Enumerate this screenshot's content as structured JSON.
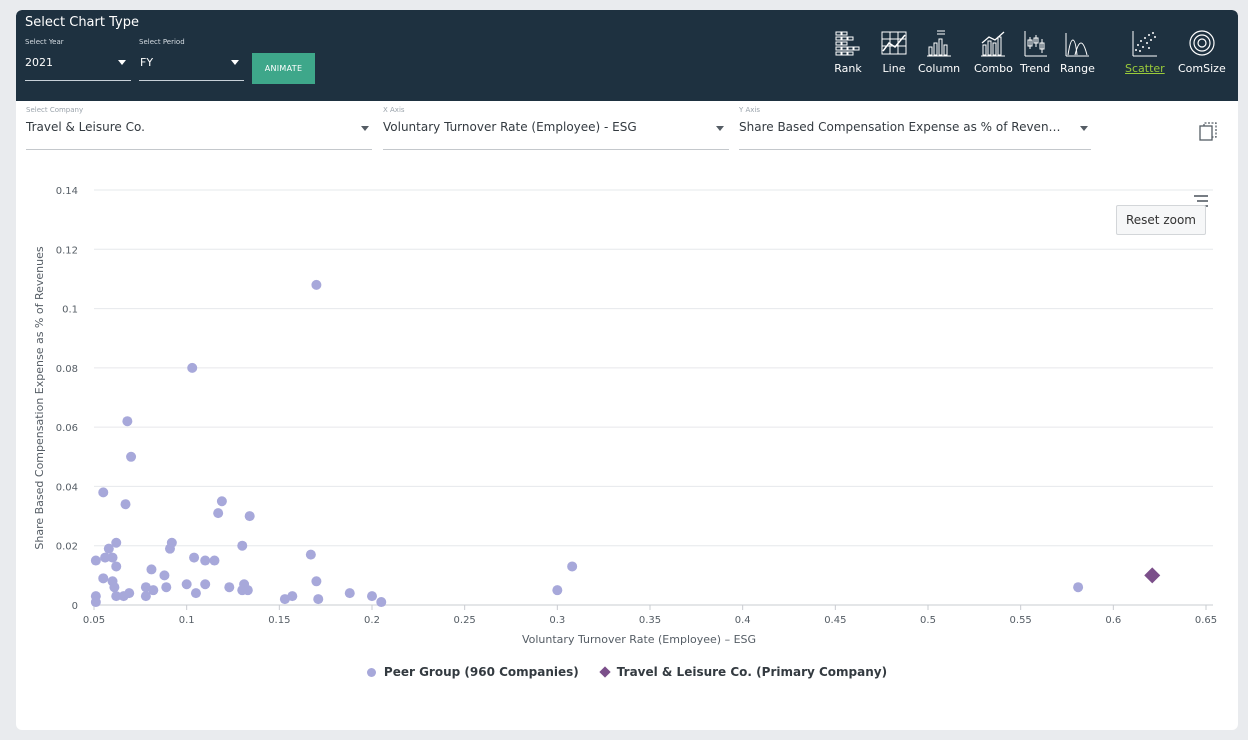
{
  "header": {
    "title": "Select Chart Type",
    "year_label": "Select Year",
    "year_value": "2021",
    "period_label": "Select Period",
    "period_value": "FY",
    "animate_label": "ANIMATE"
  },
  "chart_types": [
    {
      "label": "Rank",
      "icon": "rank-icon"
    },
    {
      "label": "Line",
      "icon": "line-icon"
    },
    {
      "label": "Column",
      "icon": "column-icon"
    },
    {
      "label": "Combo",
      "icon": "combo-icon"
    },
    {
      "label": "Trend",
      "icon": "trend-icon"
    },
    {
      "label": "Range",
      "icon": "range-icon"
    },
    {
      "label": "Scatter",
      "icon": "scatter-icon",
      "active": true
    },
    {
      "label": "ComSize",
      "icon": "comsize-icon"
    }
  ],
  "selectors": {
    "company_label": "Select Company",
    "company_value": "Travel & Leisure Co.",
    "xaxis_label": "X Axis",
    "xaxis_value": "Voluntary Turnover Rate (Employee) - ESG",
    "yaxis_label": "Y Axis",
    "yaxis_value": "Share Based Compensation Expense as % of Reven…"
  },
  "toolbar": {
    "reset_zoom_label": "Reset zoom"
  },
  "colors": {
    "header_bg": "#1e3140",
    "animate": "#3ea78a",
    "active_tab": "#9acb3a",
    "peer": "#a7a8da",
    "primary": "#7b4f8a"
  },
  "chart_data": {
    "type": "scatter",
    "xlabel": "Voluntary Turnover Rate (Employee) – ESG",
    "ylabel": "Share Based Compensation Expense as % of Revenues",
    "xlim": [
      0.05,
      0.65
    ],
    "ylim": [
      0,
      0.14
    ],
    "xticks": [
      0.05,
      0.1,
      0.15,
      0.2,
      0.25,
      0.3,
      0.35,
      0.4,
      0.45,
      0.5,
      0.55,
      0.6,
      0.65
    ],
    "xtick_labels": [
      "0.05",
      "0.1",
      "0.15",
      "0.2",
      "0.25",
      "0.3",
      "0.35",
      "0.4",
      "0.45",
      "0.5",
      "0.55",
      "0.6",
      "0.65"
    ],
    "yticks": [
      0,
      0.02,
      0.04,
      0.06,
      0.08,
      0.1,
      0.12,
      0.14
    ],
    "ytick_labels": [
      "0",
      "0.02",
      "0.04",
      "0.06",
      "0.08",
      "0.1",
      "0.12",
      "0.14"
    ],
    "grid": "horizontal",
    "legend_position": "bottom-center",
    "series": [
      {
        "name": "Peer Group (960 Companies)",
        "marker": "circle",
        "color": "#a7a8da",
        "points": [
          [
            0.17,
            0.108
          ],
          [
            0.103,
            0.08
          ],
          [
            0.068,
            0.062
          ],
          [
            0.07,
            0.05
          ],
          [
            0.055,
            0.038
          ],
          [
            0.067,
            0.034
          ],
          [
            0.119,
            0.035
          ],
          [
            0.117,
            0.031
          ],
          [
            0.134,
            0.03
          ],
          [
            0.062,
            0.021
          ],
          [
            0.058,
            0.019
          ],
          [
            0.092,
            0.021
          ],
          [
            0.13,
            0.02
          ],
          [
            0.091,
            0.019
          ],
          [
            0.167,
            0.017
          ],
          [
            0.051,
            0.015
          ],
          [
            0.056,
            0.016
          ],
          [
            0.06,
            0.016
          ],
          [
            0.104,
            0.016
          ],
          [
            0.11,
            0.015
          ],
          [
            0.115,
            0.015
          ],
          [
            0.062,
            0.013
          ],
          [
            0.081,
            0.012
          ],
          [
            0.088,
            0.01
          ],
          [
            0.055,
            0.009
          ],
          [
            0.06,
            0.008
          ],
          [
            0.1,
            0.007
          ],
          [
            0.11,
            0.007
          ],
          [
            0.131,
            0.007
          ],
          [
            0.061,
            0.006
          ],
          [
            0.078,
            0.006
          ],
          [
            0.082,
            0.005
          ],
          [
            0.089,
            0.006
          ],
          [
            0.123,
            0.006
          ],
          [
            0.17,
            0.008
          ],
          [
            0.105,
            0.004
          ],
          [
            0.13,
            0.005
          ],
          [
            0.133,
            0.005
          ],
          [
            0.051,
            0.003
          ],
          [
            0.062,
            0.003
          ],
          [
            0.066,
            0.003
          ],
          [
            0.069,
            0.004
          ],
          [
            0.078,
            0.003
          ],
          [
            0.051,
            0.001
          ],
          [
            0.153,
            0.002
          ],
          [
            0.157,
            0.003
          ],
          [
            0.171,
            0.002
          ],
          [
            0.188,
            0.004
          ],
          [
            0.2,
            0.003
          ],
          [
            0.205,
            0.001
          ],
          [
            0.3,
            0.005
          ],
          [
            0.308,
            0.013
          ],
          [
            0.581,
            0.006
          ]
        ]
      },
      {
        "name": "Travel & Leisure Co. (Primary Company)",
        "marker": "diamond",
        "color": "#7b4f8a",
        "points": [
          [
            0.621,
            0.01
          ]
        ]
      }
    ]
  }
}
